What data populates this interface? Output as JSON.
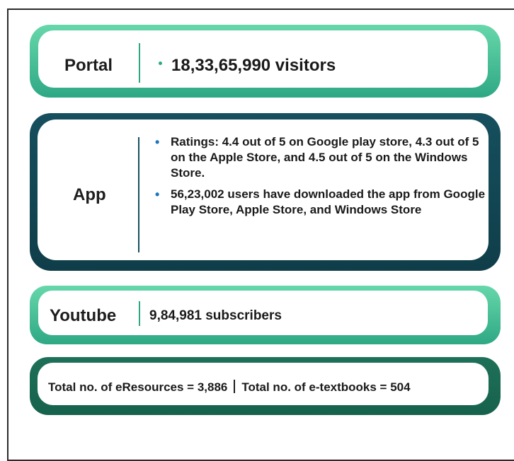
{
  "portal": {
    "label": "Portal",
    "value": "18,33,65,990 visitors"
  },
  "app": {
    "label": "App",
    "items": [
      "Ratings: 4.4 out of 5 on Google play store, 4.3 out of 5 on the Apple Store, and 4.5 out of 5 on the Windows Store.",
      "56,23,002 users have downloaded the app from Google Play Store, Apple Store, and Windows Store"
    ]
  },
  "youtube": {
    "label": "Youtube",
    "value": "9,84,981 subscribers"
  },
  "totals": {
    "eresources": "Total no. of eResources = 3,886",
    "etextbooks": "Total no. of e-textbooks = 504"
  },
  "colors": {
    "green_border": "#2ea884",
    "teal_border": "#164f5e",
    "dark_green_border": "#1f7058",
    "bullet": "#1c75bc"
  }
}
